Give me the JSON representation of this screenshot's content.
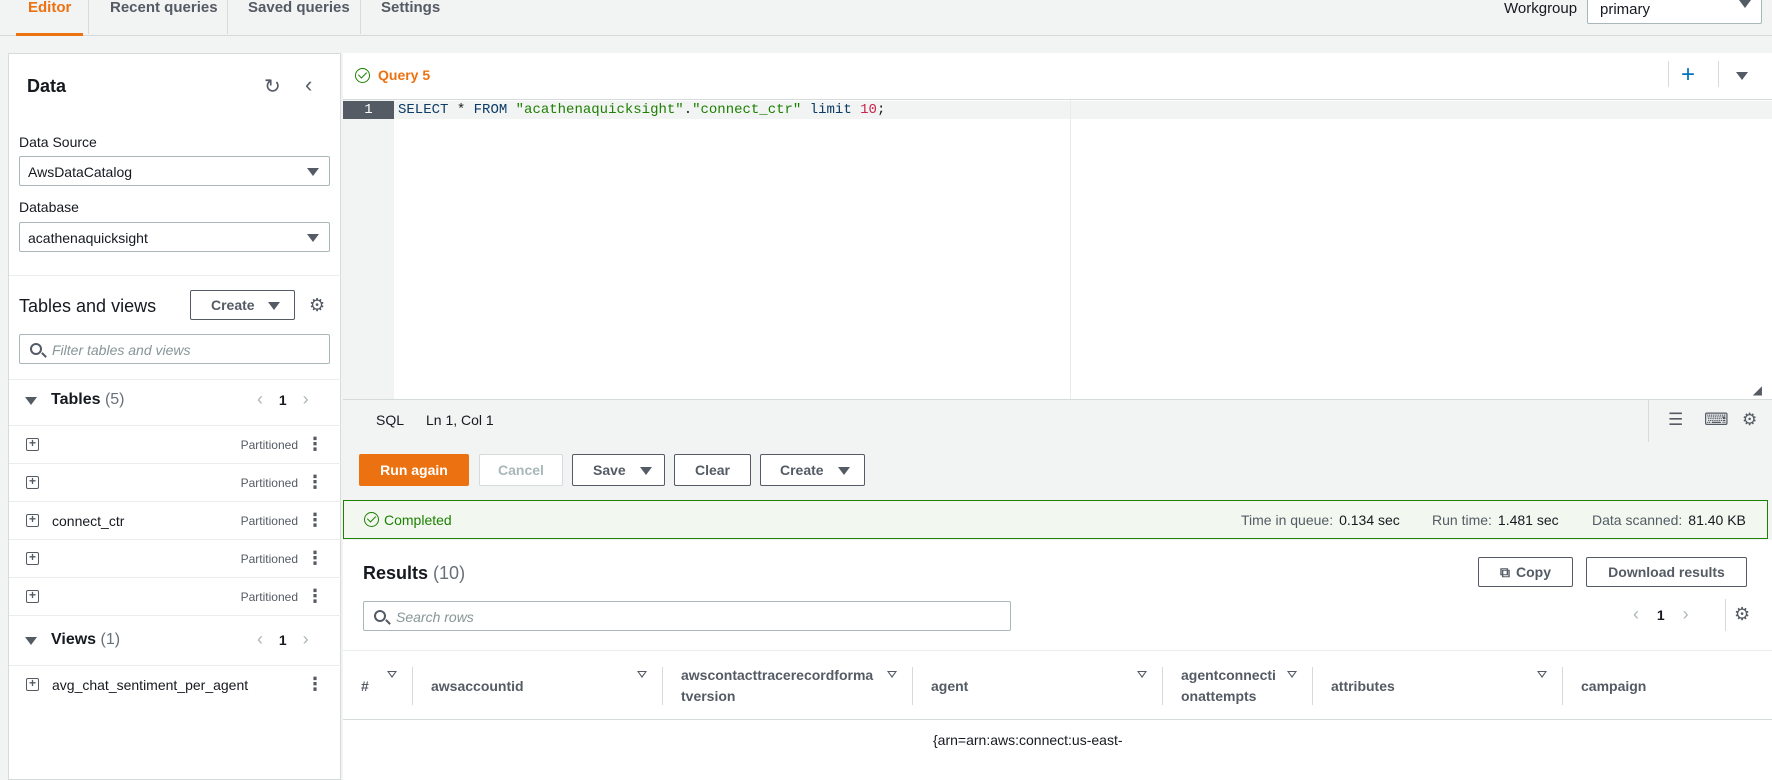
{
  "topnav": {
    "tabs": [
      {
        "label": "Editor",
        "active": true
      },
      {
        "label": "Recent queries"
      },
      {
        "label": "Saved queries"
      },
      {
        "label": "Settings"
      }
    ],
    "workgroup_label": "Workgroup",
    "workgroup_value": "primary"
  },
  "data_panel": {
    "title": "Data",
    "data_source_label": "Data Source",
    "data_source_value": "AwsDataCatalog",
    "database_label": "Database",
    "database_value": "acathenaquicksight",
    "tables_views_title": "Tables and views",
    "create_label": "Create",
    "filter_placeholder": "Filter tables and views",
    "tables": {
      "label": "Tables",
      "count": "(5)",
      "page": "1",
      "items": [
        {
          "name": "",
          "badge": "Partitioned"
        },
        {
          "name": "",
          "badge": "Partitioned"
        },
        {
          "name": "connect_ctr",
          "badge": "Partitioned"
        },
        {
          "name": "",
          "badge": "Partitioned"
        },
        {
          "name": "",
          "badge": "Partitioned"
        }
      ]
    },
    "views": {
      "label": "Views",
      "count": "(1)",
      "page": "1",
      "items": [
        {
          "name": "avg_chat_sentiment_per_agent"
        }
      ]
    }
  },
  "editor": {
    "query_tab": "Query 5",
    "line_number": "1",
    "code": {
      "kw1": "SELECT",
      "mid": " * ",
      "kw2": "FROM",
      "str1": " \"acathenaquicksight\"",
      "dot": ".",
      "str2": "\"connect_ctr\"",
      "kw3": " limit ",
      "num": "10",
      "end": ";"
    },
    "status_lang": "SQL",
    "status_pos": "Ln 1, Col 1"
  },
  "actions": {
    "run_again": "Run again",
    "cancel": "Cancel",
    "save": "Save",
    "clear": "Clear",
    "create": "Create"
  },
  "status": {
    "state": "Completed",
    "time_in_queue_label": "Time in queue:",
    "time_in_queue": "0.134 sec",
    "run_time_label": "Run time:",
    "run_time": "1.481 sec",
    "data_scanned_label": "Data scanned:",
    "data_scanned": "81.40 KB"
  },
  "results": {
    "title": "Results",
    "count": "(10)",
    "copy_label": "Copy",
    "download_label": "Download results",
    "search_placeholder": "Search rows",
    "page": "1",
    "columns": [
      "#",
      "awsaccountid",
      "awscontacttracerecordformatversion",
      "agent",
      "agentconnectionattempts",
      "attributes",
      "campaign"
    ],
    "first_row_agent": "{arn=arn:aws:connect:us-east-"
  }
}
